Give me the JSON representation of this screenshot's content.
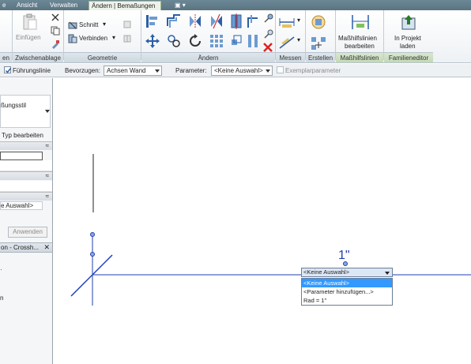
{
  "tabs": [
    {
      "label": "e"
    },
    {
      "label": "Ansicht"
    },
    {
      "label": "Verwalten"
    },
    {
      "label": "Ändern | Bemaßungen",
      "active": true
    }
  ],
  "quick_access_label": "▣ ▾",
  "ribbon": {
    "panels": [
      {
        "label": "en"
      },
      {
        "label": "Zwischenablage"
      },
      {
        "label": "Geometrie"
      },
      {
        "label": "Ändern"
      },
      {
        "label": "Messen"
      },
      {
        "label": "Erstellen"
      },
      {
        "label": "Maßhilfslinien"
      },
      {
        "label": "Familieneditor"
      }
    ],
    "paste_label": "Einfügen",
    "cut_label": "Schnitt",
    "join_label": "Verbinden",
    "edit_witness_label_1": "Maßhilfslinien",
    "edit_witness_label_2": "bearbeiten",
    "load_project_label_1": "In Projekt",
    "load_project_label_2": "laden"
  },
  "options_bar": {
    "leader_label": "Führungslinie",
    "leader_checked": true,
    "prefer_label": "Bevorzugen:",
    "prefer_value": "Achsen Wand",
    "parameter_label": "Parameter:",
    "parameter_value": "<Keine Auswahl>",
    "instance_param_label": "Exemplarparameter",
    "instance_param_checked": false
  },
  "properties": {
    "type_name": "ßungsstil",
    "edit_type_label": "Typ bearbeiten",
    "label_value": "e Auswahl>",
    "apply_label": "Anwenden",
    "browser_title": "on - Crossh..."
  },
  "canvas": {
    "dimension_text": "1\"",
    "dropdown_value": "<Keine Auswahl>",
    "dropdown_options": [
      "<Keine Auswahl>",
      "<Parameter hinzufügen...>",
      "Rad = 1\""
    ],
    "selected_index": 0
  },
  "colors": {
    "ribbon_active": "#eef3ea",
    "dimension_line": "#1f3fb5",
    "selection": "#3399ff"
  }
}
